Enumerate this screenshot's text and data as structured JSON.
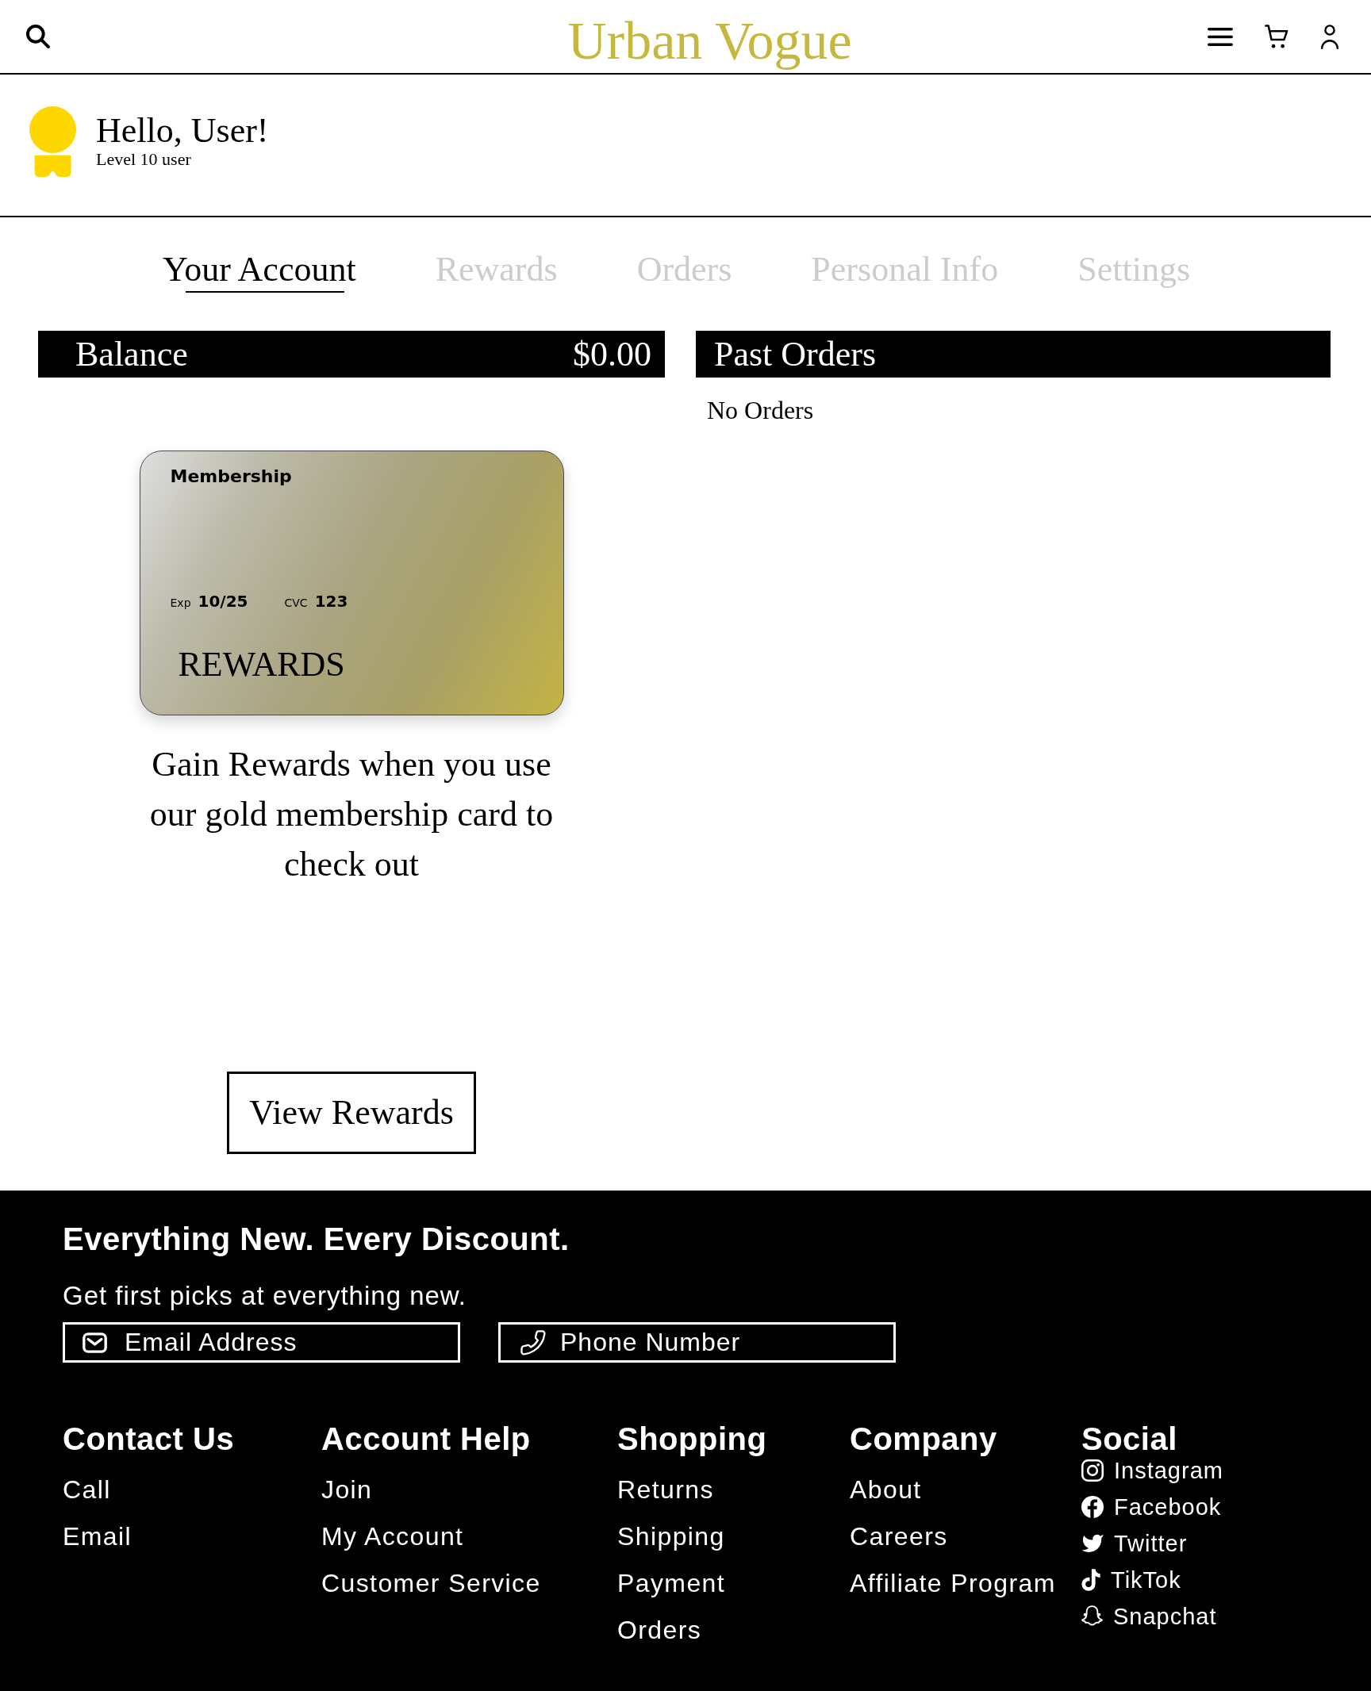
{
  "header": {
    "title": "Urban Vogue"
  },
  "greeting": {
    "title": "Hello, User!",
    "subtitle": "Level 10 user"
  },
  "tabs": [
    {
      "label": "Your Account",
      "selected": true
    },
    {
      "label": "Rewards",
      "selected": false
    },
    {
      "label": "Orders",
      "selected": false
    },
    {
      "label": "Personal Info",
      "selected": false
    },
    {
      "label": "Settings",
      "selected": false
    }
  ],
  "balance": {
    "label": "Balance",
    "amount": "$0.00"
  },
  "membership_card": {
    "title": "Membership",
    "expiry_label": "Exp",
    "expiry": "10/25",
    "cvc_label": "CVC",
    "cvc": "123",
    "name": "REWARDS"
  },
  "rewards_text": "Gain Rewards when you use our gold membership card to check out",
  "view_rewards_button": "View Rewards",
  "past_orders": {
    "title": "Past Orders",
    "empty_text": "No Orders"
  },
  "footer": {
    "headline": "Everything New. Every Discount.",
    "subtext": "Get first picks at everything new.",
    "fields": [
      {
        "kind": "email",
        "placeholder": "Email Address"
      },
      {
        "kind": "phone",
        "placeholder": "Phone Number"
      }
    ],
    "columns": [
      {
        "kind": "links",
        "title": "Contact Us",
        "links": [
          "Call",
          "Email"
        ]
      },
      {
        "kind": "links",
        "title": "Account Help",
        "links": [
          "Join",
          "My Account",
          "Customer Service"
        ]
      },
      {
        "kind": "links",
        "title": "Shopping",
        "links": [
          "Returns",
          "Shipping",
          "Payment",
          "Orders"
        ]
      },
      {
        "kind": "links",
        "title": "Company",
        "links": [
          "About",
          "Careers",
          "Affiliate Program"
        ]
      },
      {
        "kind": "social",
        "title": "Social",
        "links": [
          {
            "kind": "instagram",
            "label": "Instagram"
          },
          {
            "kind": "facebook",
            "label": "Facebook"
          },
          {
            "kind": "twitter",
            "label": "Twitter"
          },
          {
            "kind": "tiktok",
            "label": "TikTok"
          },
          {
            "kind": "snapchat",
            "label": "Snapchat"
          }
        ]
      }
    ]
  }
}
